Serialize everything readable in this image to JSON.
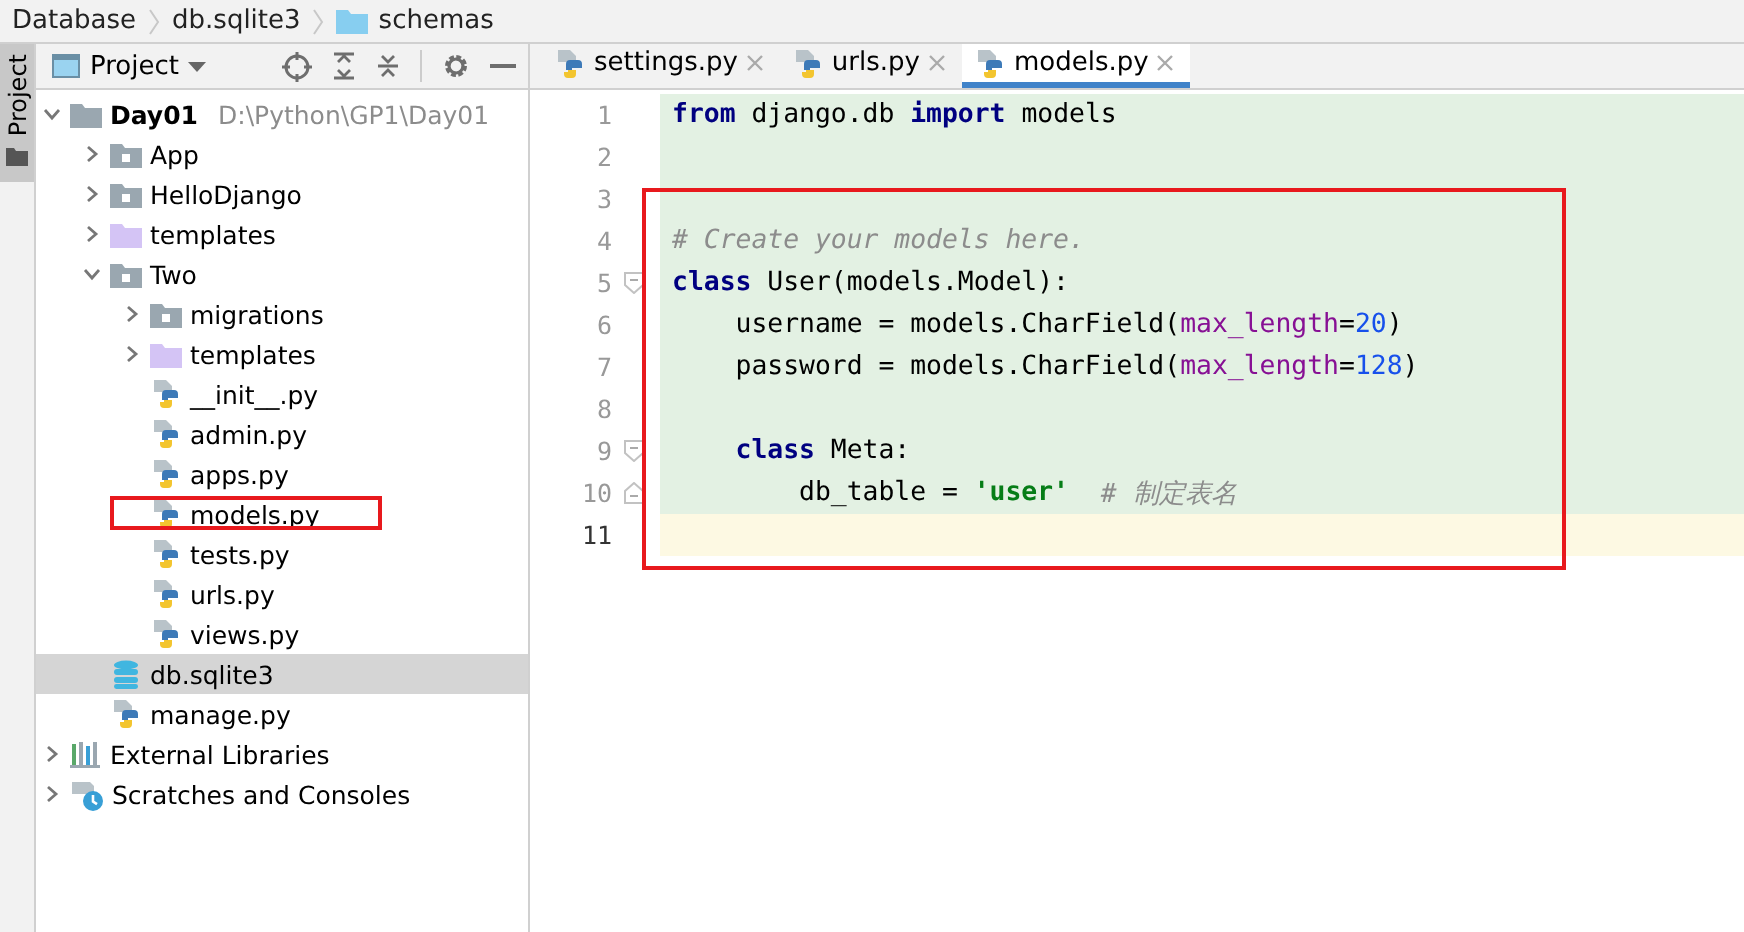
{
  "breadcrumbs": [
    {
      "label": "Database",
      "kind": "text"
    },
    {
      "label": "db.sqlite3",
      "kind": "text"
    },
    {
      "label": "schemas",
      "kind": "folder"
    }
  ],
  "tool_window_strip": {
    "tabs": [
      {
        "label": "Project",
        "selected": true
      }
    ]
  },
  "project_panel": {
    "title": "Project",
    "tree": [
      {
        "label": "Day01",
        "path": "D:\\Python\\GP1\\Day01",
        "kind": "root",
        "expanded": true,
        "selected": false,
        "annotated": false,
        "children": [
          {
            "label": "App",
            "kind": "module",
            "expanded": false,
            "selected": false,
            "annotated": false
          },
          {
            "label": "HelloDjango",
            "kind": "module",
            "expanded": false,
            "selected": false,
            "annotated": false
          },
          {
            "label": "templates",
            "kind": "templates",
            "expanded": false,
            "selected": false,
            "annotated": false
          },
          {
            "label": "Two",
            "kind": "module",
            "expanded": true,
            "selected": false,
            "annotated": false,
            "children": [
              {
                "label": "migrations",
                "kind": "module",
                "expanded": false,
                "selected": false,
                "annotated": false
              },
              {
                "label": "templates",
                "kind": "templates",
                "expanded": false,
                "selected": false,
                "annotated": false
              },
              {
                "label": "__init__.py",
                "kind": "python",
                "selected": false,
                "annotated": false
              },
              {
                "label": "admin.py",
                "kind": "python",
                "selected": false,
                "annotated": false
              },
              {
                "label": "apps.py",
                "kind": "python",
                "selected": false,
                "annotated": false
              },
              {
                "label": "models.py",
                "kind": "python",
                "selected": false,
                "annotated": true
              },
              {
                "label": "tests.py",
                "kind": "python",
                "selected": false,
                "annotated": false
              },
              {
                "label": "urls.py",
                "kind": "python",
                "selected": false,
                "annotated": false
              },
              {
                "label": "views.py",
                "kind": "python",
                "selected": false,
                "annotated": false
              }
            ]
          },
          {
            "label": "db.sqlite3",
            "kind": "database",
            "selected": true,
            "annotated": false
          },
          {
            "label": "manage.py",
            "kind": "python",
            "selected": false,
            "annotated": false
          }
        ]
      },
      {
        "label": "External Libraries",
        "kind": "libraries",
        "expanded": false,
        "selected": false,
        "annotated": false
      },
      {
        "label": "Scratches and Consoles",
        "kind": "scratches",
        "expanded": false,
        "selected": false,
        "annotated": false
      }
    ]
  },
  "editor": {
    "tabs": [
      {
        "label": "settings.py",
        "selected": false
      },
      {
        "label": "urls.py",
        "selected": false
      },
      {
        "label": "models.py",
        "selected": true
      }
    ],
    "blocks": [
      {
        "annotated": false,
        "lines": [
          {
            "number": "1",
            "current": false,
            "tokens": [
              {
                "kind": "keyword",
                "text": "from"
              },
              {
                "kind": "plain",
                "text": " django.db "
              },
              {
                "kind": "keyword",
                "text": "import"
              },
              {
                "kind": "plain",
                "text": " models"
              }
            ]
          },
          {
            "number": "2",
            "current": false
          }
        ]
      },
      {
        "annotated": true,
        "lines": [
          {
            "number": "3",
            "current": false
          },
          {
            "number": "4",
            "current": false,
            "tokens": [
              {
                "kind": "comment",
                "text": "# Create your models here."
              }
            ]
          },
          {
            "number": "5",
            "fold": {
              "kind": "start"
            },
            "current": false,
            "tokens": [
              {
                "kind": "keyword",
                "text": "class"
              },
              {
                "kind": "plain",
                "text": " User(models.Model):"
              }
            ]
          },
          {
            "number": "6",
            "current": false,
            "tokens": [
              {
                "kind": "plain",
                "text": "    username = models.CharField("
              },
              {
                "kind": "param",
                "text": "max_length"
              },
              {
                "kind": "plain",
                "text": "="
              },
              {
                "kind": "number",
                "text": "20"
              },
              {
                "kind": "plain",
                "text": ")"
              }
            ]
          },
          {
            "number": "7",
            "current": false,
            "tokens": [
              {
                "kind": "plain",
                "text": "    password = models.CharField("
              },
              {
                "kind": "param",
                "text": "max_length"
              },
              {
                "kind": "plain",
                "text": "="
              },
              {
                "kind": "number",
                "text": "128"
              },
              {
                "kind": "plain",
                "text": ")"
              }
            ]
          },
          {
            "number": "8",
            "current": false
          },
          {
            "number": "9",
            "fold": {
              "kind": "start"
            },
            "current": false,
            "tokens": [
              {
                "kind": "keyword",
                "text": "    class"
              },
              {
                "kind": "plain",
                "text": " Meta:"
              }
            ]
          },
          {
            "number": "10",
            "fold": {
              "kind": "end"
            },
            "current": false,
            "tokens": [
              {
                "kind": "plain",
                "text": "        db_table = "
              },
              {
                "kind": "string",
                "text": "'user'"
              },
              {
                "kind": "comment",
                "text": "  # 制定表名"
              }
            ]
          },
          {
            "number": "11",
            "current": true
          }
        ]
      }
    ]
  }
}
